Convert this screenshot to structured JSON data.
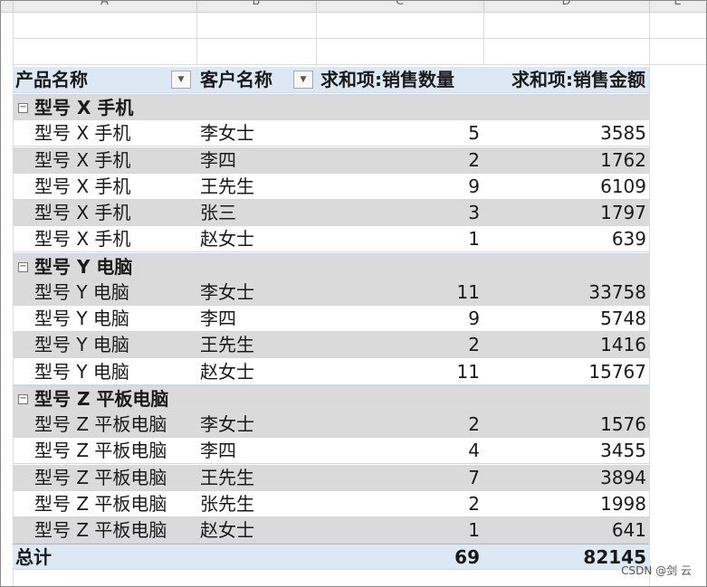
{
  "column_headers": [
    "A",
    "B",
    "C",
    "D",
    "E"
  ],
  "pivot": {
    "headers": {
      "product": "产品名称",
      "customer": "客户名称",
      "qty": "求和项:销售数量",
      "amount": "求和项:销售金额",
      "filter_icon": "dropdown-arrow-icon",
      "filter_glyph": "▼"
    },
    "group_toggle_glyph": "−",
    "groups": [
      {
        "name": "型号 X 手机",
        "rows": [
          {
            "product": "型号 X 手机",
            "customer": "李女士",
            "qty": "5",
            "amount": "3585"
          },
          {
            "product": "型号 X 手机",
            "customer": "李四",
            "qty": "2",
            "amount": "1762"
          },
          {
            "product": "型号 X 手机",
            "customer": "王先生",
            "qty": "9",
            "amount": "6109"
          },
          {
            "product": "型号 X 手机",
            "customer": "张三",
            "qty": "3",
            "amount": "1797"
          },
          {
            "product": "型号 X 手机",
            "customer": "赵女士",
            "qty": "1",
            "amount": "639"
          }
        ]
      },
      {
        "name": "型号 Y 电脑",
        "rows": [
          {
            "product": "型号 Y 电脑",
            "customer": "李女士",
            "qty": "11",
            "amount": "33758"
          },
          {
            "product": "型号 Y 电脑",
            "customer": "李四",
            "qty": "9",
            "amount": "5748"
          },
          {
            "product": "型号 Y 电脑",
            "customer": "王先生",
            "qty": "2",
            "amount": "1416"
          },
          {
            "product": "型号 Y 电脑",
            "customer": "赵女士",
            "qty": "11",
            "amount": "15767"
          }
        ]
      },
      {
        "name": "型号 Z 平板电脑",
        "rows": [
          {
            "product": "型号 Z 平板电脑",
            "customer": "李女士",
            "qty": "2",
            "amount": "1576"
          },
          {
            "product": "型号 Z 平板电脑",
            "customer": "李四",
            "qty": "4",
            "amount": "3455"
          },
          {
            "product": "型号 Z 平板电脑",
            "customer": "王先生",
            "qty": "7",
            "amount": "3894"
          },
          {
            "product": "型号 Z 平板电脑",
            "customer": "张先生",
            "qty": "2",
            "amount": "1998"
          },
          {
            "product": "型号 Z 平板电脑",
            "customer": "赵女士",
            "qty": "1",
            "amount": "641"
          }
        ]
      }
    ],
    "total": {
      "label": "总计",
      "qty": "69",
      "amount": "82145"
    }
  },
  "watermark": "CSDN @剑 云",
  "colors": {
    "header_blue": "#dde8f5",
    "row_shade": "#dadada",
    "grid": "#dcdcdc"
  }
}
